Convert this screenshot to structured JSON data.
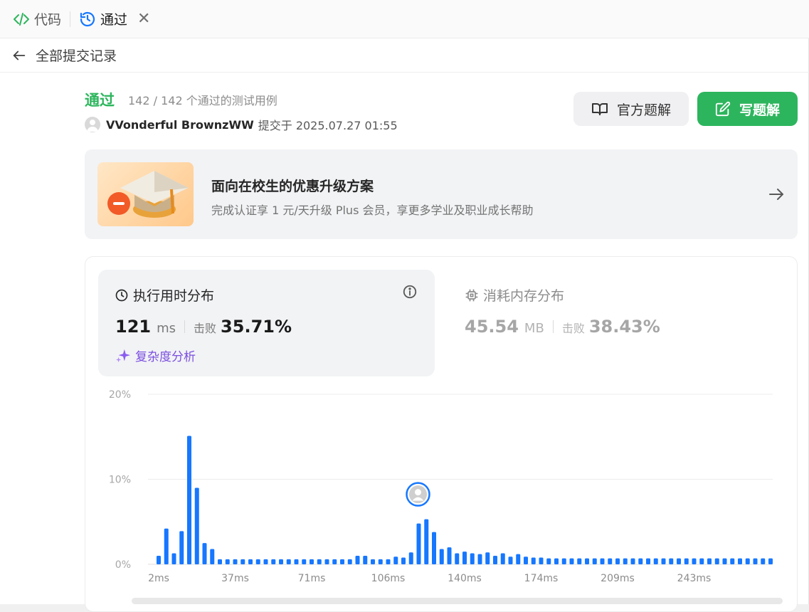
{
  "tabs": [
    {
      "label": "代码",
      "icon": "code-icon",
      "color": "#2db55d"
    },
    {
      "label": "通过",
      "icon": "history-icon",
      "color": "#1677ff"
    }
  ],
  "header": {
    "back_label": "全部提交记录"
  },
  "result": {
    "status": "通过",
    "cases_text": "142 / 142 个通过的测试用例",
    "user_name": "VVonderful BrownzWW",
    "submit_text": "提交于 2025.07.27 01:55"
  },
  "buttons": {
    "official": "官方题解",
    "write": "写题解"
  },
  "promo": {
    "title": "面向在校生的优惠升级方案",
    "desc": "完成认证享 1 元/天升级 Plus 会员，享更多学业及职业成长帮助"
  },
  "runtime": {
    "title": "执行用时分布",
    "value": "121",
    "unit": "ms",
    "beat_label": "击败",
    "beat_pct": "35.71%",
    "complexity_label": "复杂度分析"
  },
  "memory": {
    "title": "消耗内存分布",
    "value": "45.54",
    "unit": "MB",
    "beat_label": "击败",
    "beat_pct": "38.43%"
  },
  "colors": {
    "accent_green": "#2db55d",
    "bar_blue": "#1677ff",
    "purple": "#7b4fe0"
  },
  "chart_data": {
    "type": "bar",
    "title": "",
    "xlabel": "",
    "ylabel": "",
    "ylim": [
      0,
      20
    ],
    "y_ticks": [
      "0%",
      "10%",
      "20%"
    ],
    "x_tick_labels": [
      "2ms",
      "37ms",
      "71ms",
      "106ms",
      "140ms",
      "174ms",
      "209ms",
      "243ms"
    ],
    "x_tick_bar_index": [
      0,
      10,
      20,
      30,
      40,
      50,
      60,
      70
    ],
    "user_bar_index": 34,
    "grid": true,
    "values": [
      1.0,
      4.2,
      1.3,
      3.9,
      15.1,
      9.0,
      2.5,
      1.8,
      0.6,
      0.6,
      0.6,
      0.6,
      0.6,
      0.6,
      0.6,
      0.6,
      0.6,
      0.6,
      0.6,
      0.6,
      0.6,
      0.6,
      0.6,
      0.6,
      0.6,
      0.6,
      1.0,
      1.0,
      0.6,
      0.6,
      0.6,
      0.9,
      0.8,
      1.4,
      4.8,
      5.3,
      3.8,
      1.8,
      2.0,
      1.3,
      1.5,
      1.3,
      1.2,
      1.4,
      1.0,
      1.3,
      0.9,
      1.2,
      0.9,
      0.8,
      0.8,
      0.7,
      0.7,
      0.7,
      0.7,
      0.7,
      0.7,
      0.7,
      0.7,
      0.7,
      0.7,
      0.7,
      0.7,
      0.7,
      0.7,
      0.7,
      0.7,
      0.7,
      0.7,
      0.7,
      0.7,
      0.7,
      0.7,
      0.7,
      0.7,
      0.7,
      0.7,
      0.7,
      0.7,
      0.7,
      0.7
    ]
  }
}
